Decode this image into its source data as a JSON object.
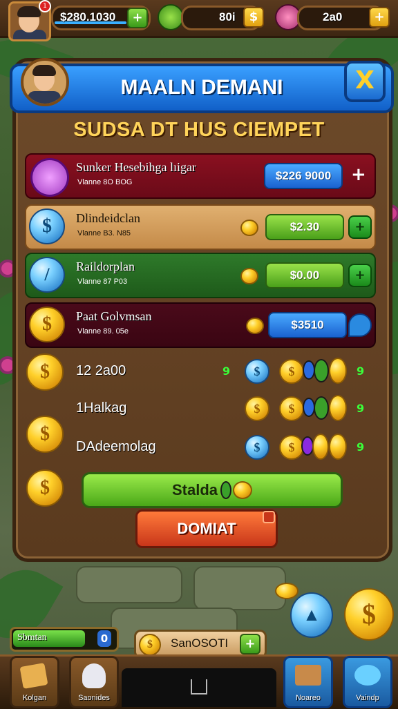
{
  "hud": {
    "money": "$280.1030",
    "coins": "80i",
    "gems": "2a0",
    "notif_count": "1"
  },
  "panel": {
    "title": "MAALN DEMANI",
    "subtitle": "SUDSA DT HUS CIEMPET",
    "close_label": "X"
  },
  "rows": [
    {
      "name": "Sunker Hesebihga lıigar",
      "sub": "Vlanne 8O BOG",
      "price": "$226 9000",
      "side": "+"
    },
    {
      "name": "Dlindeidclan",
      "sub": "Vlanne B3. N85",
      "price": "$2.30",
      "side": "+"
    },
    {
      "name": "Raildorplan",
      "sub": "Vlanne 87 P03",
      "price": "$0.00",
      "side": "+"
    },
    {
      "name": "Paat Golvmsan",
      "sub": "Vlanne 89. 05e",
      "price": "$3510",
      "side": ""
    }
  ],
  "stats": [
    {
      "label": "12 2a00",
      "mark_left": "9",
      "mark_right": "9"
    },
    {
      "label": "1Halkag",
      "mark_right": "9"
    },
    {
      "label": "DAdeemolag",
      "mark_right": "9"
    }
  ],
  "actions": {
    "green_label": "Stalda",
    "donate_label": "DOMIAT"
  },
  "bottom": {
    "progress_label": "Sbmtan",
    "progress_badge": "0",
    "center_label": "SanOSOTI",
    "tiles": [
      "Kolgan",
      "Saonides",
      "Noareo",
      "Vaindp"
    ]
  },
  "colors": {
    "banner": "#1a6ad0",
    "panel": "#6d4a2a",
    "accent_gold": "#ffd02a"
  }
}
